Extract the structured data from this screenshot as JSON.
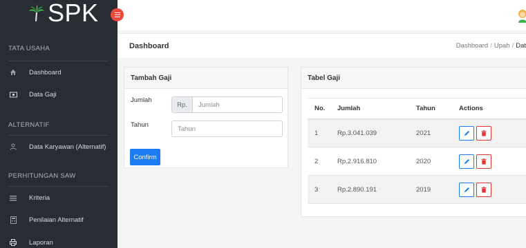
{
  "brand": {
    "name": "SPK",
    "logo_icon": "palm-tree-icon",
    "toggle_icon": "menu-icon"
  },
  "sidebar": {
    "sections": [
      {
        "title": "TATA USAHA",
        "items": [
          {
            "label": "Dashboard",
            "icon": "home-icon"
          },
          {
            "label": "Data Gaji",
            "icon": "money-icon"
          }
        ]
      },
      {
        "title": "ALTERNATIF",
        "items": [
          {
            "label": "Data Karyawan (Alternatif)",
            "icon": "user-icon"
          }
        ]
      },
      {
        "title": "PERHITUNGAN SAW",
        "items": [
          {
            "label": "Kriteria",
            "icon": "list-icon"
          },
          {
            "label": "Penilaian Alternatif",
            "icon": "calculator-icon"
          },
          {
            "label": "Laporan",
            "icon": "print-icon"
          }
        ]
      }
    ]
  },
  "header": {
    "title": "Dashboard",
    "breadcrumb": [
      "Dashboard",
      "Upah",
      "Dat"
    ]
  },
  "form": {
    "title": "Tambah Gaji",
    "jumlah_label": "Jumlah",
    "jumlah_prefix": "Rp.",
    "jumlah_placeholder": "Jumlah",
    "tahun_label": "Tahun",
    "tahun_placeholder": "Tahun",
    "confirm_label": "Confirm"
  },
  "table": {
    "title": "Tabel Gaji",
    "columns": [
      "No.",
      "Jumlah",
      "Tahun",
      "Actions"
    ],
    "rows": [
      {
        "no": "1",
        "jumlah": "Rp.3.041.039",
        "tahun": "2021"
      },
      {
        "no": "2",
        "jumlah": "Rp.2.916.810",
        "tahun": "2020"
      },
      {
        "no": "3",
        "jumlah": "Rp.2.890.191",
        "tahun": "2019"
      }
    ]
  },
  "colors": {
    "sidebar_bg": "#282d34",
    "primary": "#1b7bf3",
    "danger": "#e3342f",
    "toggle": "#ee4a3c",
    "logo_green": "#3cb54a"
  }
}
